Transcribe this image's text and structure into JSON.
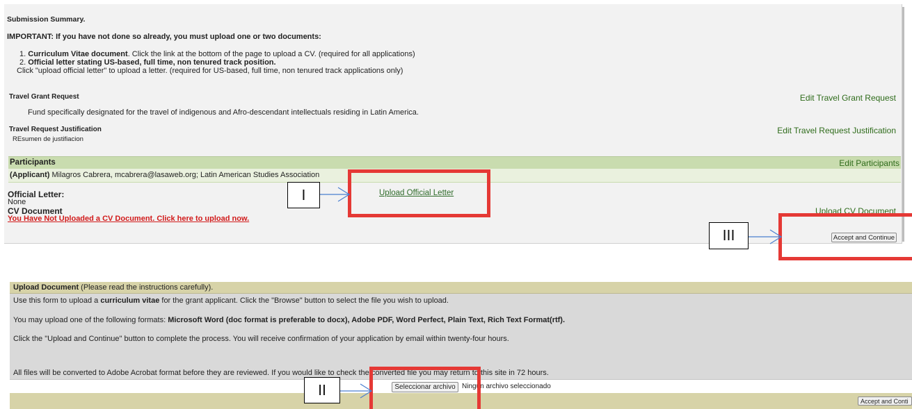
{
  "summary": {
    "title": "Submission Summary.",
    "important": "IMPORTANT: If you have not done so already, you must upload one or two documents:",
    "item1_num": "1.",
    "item1_bold": "Curriculum Vitae document",
    "item1_rest": ". Click the link at the bottom of the page to upload a CV. (required for all applications)",
    "item2_num": "2.",
    "item2_bold": "Official letter stating US-based, full time, non tenured track position.",
    "item2_note": "Click \"upload official letter\" to upload a letter. (required for US-based, full time, non tenured track applications only)",
    "travel_grant_label": "Travel Grant Request",
    "travel_grant_text": "Fund specifically designated for the travel of indigenous and Afro-descendant intellectuals residing in Latin America.",
    "edit_travel_grant": "Edit Travel Grant Request",
    "justification_label": "Travel Request Justification",
    "justification_text": "REsumen de justifiacion",
    "edit_justification": "Edit Travel Request Justification",
    "participants_label": "Participants",
    "edit_participants": "Edit Participants",
    "applicant_role": "(Applicant)",
    "applicant_info": " Milagros Cabrera, mcabrera@lasaweb.org; Latin American Studies Association",
    "official_letter_label": "Official Letter:",
    "official_letter_value": "None",
    "upload_official_letter": "Upload Official Letter",
    "cv_label": "CV Document",
    "cv_warning": "You Have Not Uploaded a CV Document. Click here to upload now.",
    "upload_cv": "Upload CV Document",
    "accept_button": "Accept and Continue"
  },
  "annotations": {
    "mark1": "I",
    "mark2": "II",
    "mark3": "III"
  },
  "upload": {
    "header_bold": "Upload Document",
    "header_rest": " (Please read the instructions carefully).",
    "line1_a": "Use this form to upload a ",
    "line1_b": "curriculum vitae",
    "line1_c": " for the grant applicant. Click the \"Browse\" button to select the file you wish to upload.",
    "line2_a": "You may upload one of the following formats: ",
    "line2_b": "Microsoft Word (doc format is preferable to docx), Adobe PDF, Word Perfect, Plain Text, Rich Text Format(rtf).",
    "line3": "Click the \"Upload and Continue\" button to complete the process. You will receive confirmation of your application by email within twenty-four hours.",
    "line4": "All files will be converted to Adobe Acrobat format before they are reviewed. If you would like to check the converted file you may return to this site in 72 hours.",
    "choose_file_button": "Seleccionar archivo",
    "no_file_text": "Ningún archivo seleccionado",
    "accept_button": "Accept and Conti"
  },
  "colors": {
    "annotation_red": "#e53935",
    "arrow_blue": "#4a7fd0",
    "link_green": "#2e6b1a",
    "warning_red": "#d11a1a"
  }
}
